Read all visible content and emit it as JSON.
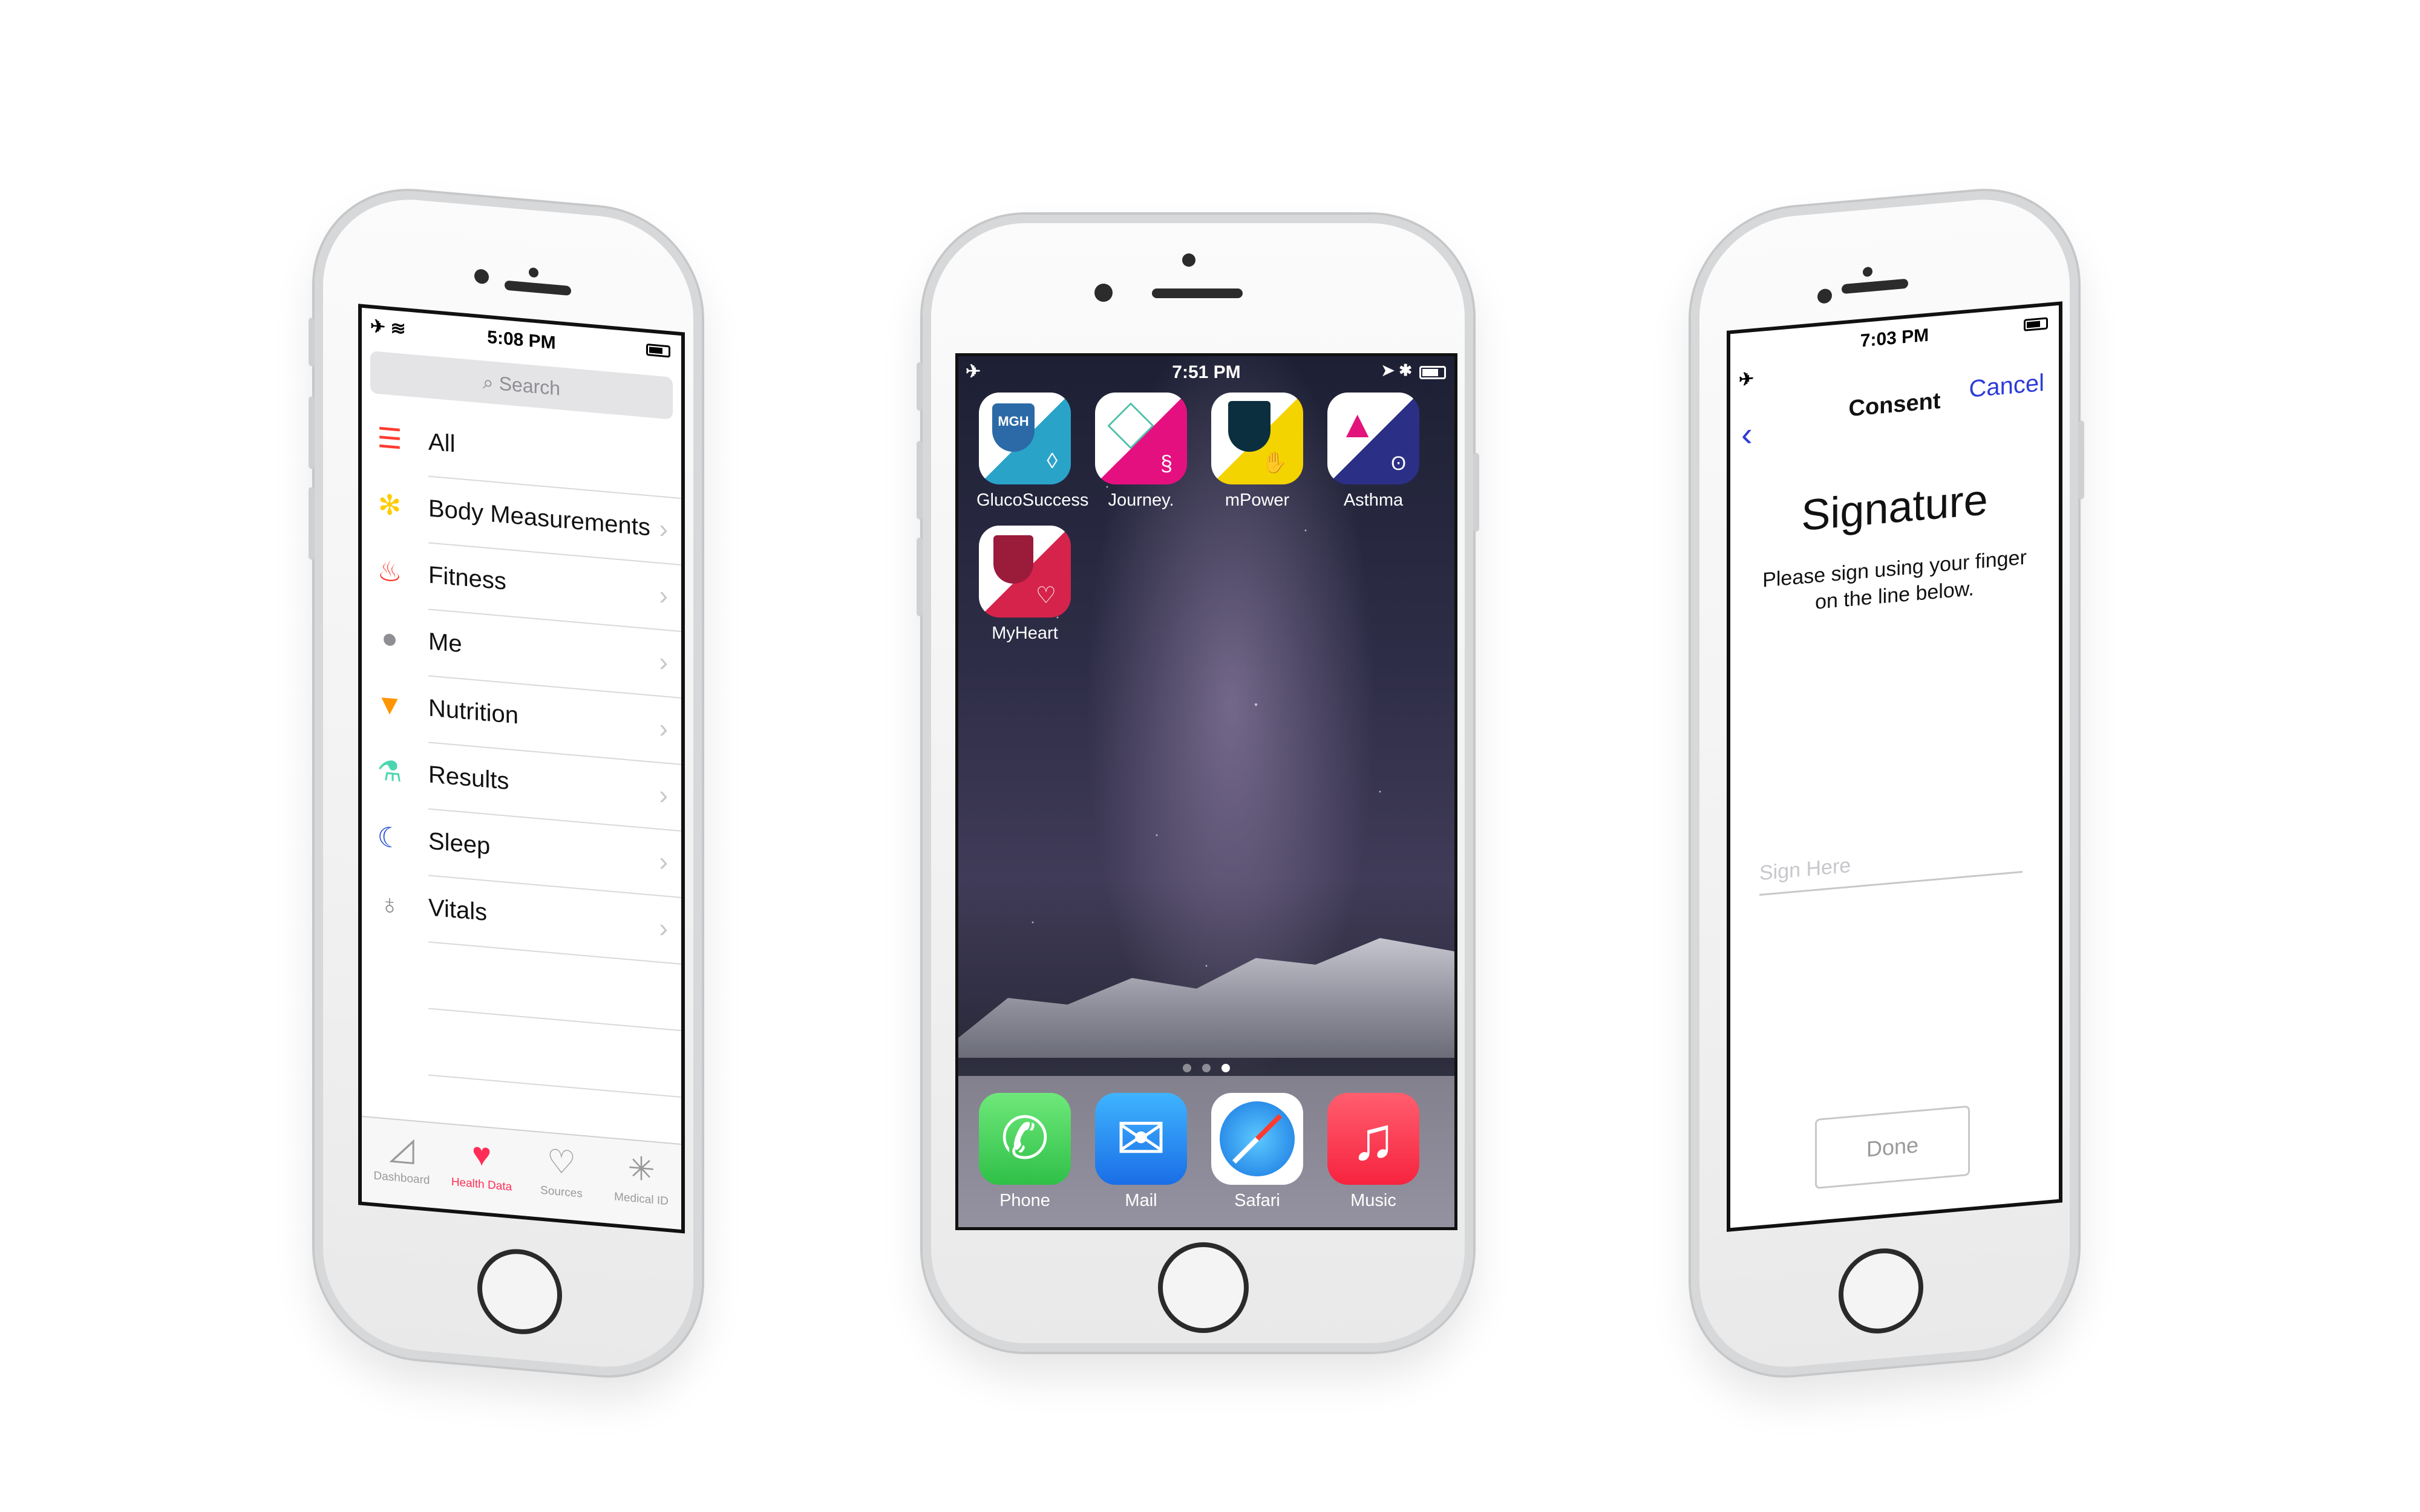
{
  "left_phone": {
    "status": {
      "time": "5:08 PM",
      "left_icons": "✈ ≋"
    },
    "search": {
      "placeholder": "Search"
    },
    "categories": [
      {
        "label": "All",
        "icon": "list-icon",
        "color": "#ff3b30"
      },
      {
        "label": "Body Measurements",
        "icon": "person-icon",
        "color": "#ffcc00"
      },
      {
        "label": "Fitness",
        "icon": "flame-icon",
        "color": "#ff3b30"
      },
      {
        "label": "Me",
        "icon": "head-icon",
        "color": "#8e8e93"
      },
      {
        "label": "Nutrition",
        "icon": "carrot-icon",
        "color": "#ff9500"
      },
      {
        "label": "Results",
        "icon": "flask-icon",
        "color": "#4cd6b0"
      },
      {
        "label": "Sleep",
        "icon": "moon-icon",
        "color": "#2c56d8"
      },
      {
        "label": "Vitals",
        "icon": "stethoscope-icon",
        "color": "#8e8e93"
      }
    ],
    "tabs": [
      {
        "label": "Dashboard",
        "icon": "chart-icon"
      },
      {
        "label": "Health Data",
        "icon": "folder-heart-icon"
      },
      {
        "label": "Sources",
        "icon": "heart-arrow-icon"
      },
      {
        "label": "Medical ID",
        "icon": "asterisk-icon"
      }
    ],
    "active_tab": "Health Data",
    "accent": "#ff2d55"
  },
  "center_phone": {
    "status": {
      "time": "7:51 PM"
    },
    "apps": [
      {
        "name": "GlucoSuccess",
        "badge": "MGH",
        "colors": [
          "#2b6aa6",
          "#2aa3c9"
        ]
      },
      {
        "name": "Journey.",
        "badge": "",
        "colors": [
          "#e5107f",
          "#4dbfa8"
        ]
      },
      {
        "name": "mPower",
        "badge": "",
        "colors": [
          "#0b2f3f",
          "#f3d300"
        ]
      },
      {
        "name": "Asthma",
        "badge": "",
        "colors": [
          "#e2147b",
          "#2b2f86"
        ]
      },
      {
        "name": "MyHeart",
        "badge": "",
        "colors": [
          "#9b1b3a",
          "#d6234b"
        ]
      }
    ],
    "dock": [
      {
        "name": "Phone",
        "icon": "phone-icon",
        "color": "#4cd964"
      },
      {
        "name": "Mail",
        "icon": "mail-icon",
        "color": "#1e8ef7"
      },
      {
        "name": "Safari",
        "icon": "compass-icon",
        "color": "#1f8ff0"
      },
      {
        "name": "Music",
        "icon": "music-note-icon",
        "color": "#fc3d50"
      }
    ],
    "pages": 3,
    "current_page": 3
  },
  "right_phone": {
    "status": {
      "time": "7:03 PM"
    },
    "nav_title": "Consent",
    "cancel_label": "Cancel",
    "heading": "Signature",
    "subtitle": "Please sign using your finger on the line below.",
    "sign_placeholder": "Sign Here",
    "done_label": "Done",
    "accent": "#2e3bd9"
  }
}
